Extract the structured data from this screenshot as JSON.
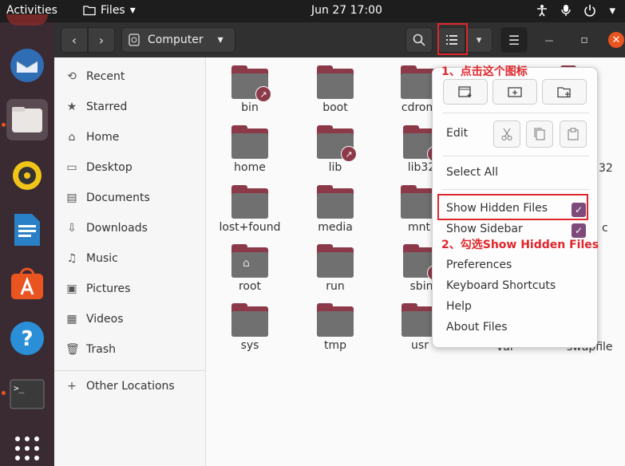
{
  "topbar": {
    "activities": "Activities",
    "app_name": "Files",
    "app_menu_arrow": "▾",
    "clock": "Jun 27  17:00"
  },
  "dock": {
    "items": [
      {
        "name": "thunderbird-icon"
      },
      {
        "name": "files-icon"
      },
      {
        "name": "rhythmbox-icon"
      },
      {
        "name": "writer-icon"
      },
      {
        "name": "app-center-icon"
      },
      {
        "name": "help-icon"
      },
      {
        "name": "terminal-icon"
      },
      {
        "name": "show-apps-icon"
      }
    ]
  },
  "header": {
    "back": "‹",
    "forward": "›",
    "location": "Computer",
    "location_arrow": "▾",
    "search": "⌕",
    "menu_arrow": "▾",
    "hamburger": "☰",
    "minimize": "—",
    "maximize": "▫",
    "close": "✕"
  },
  "sidebar": {
    "items": [
      {
        "label": "Recent",
        "icon": "⟲"
      },
      {
        "label": "Starred",
        "icon": "★"
      },
      {
        "label": "Home",
        "icon": "⌂"
      },
      {
        "label": "Desktop",
        "icon": "▭"
      },
      {
        "label": "Documents",
        "icon": "▤"
      },
      {
        "label": "Downloads",
        "icon": "⇩"
      },
      {
        "label": "Music",
        "icon": "♫"
      },
      {
        "label": "Pictures",
        "icon": "▣"
      },
      {
        "label": "Videos",
        "icon": "▦"
      },
      {
        "label": "Trash",
        "icon": "🗑"
      }
    ],
    "other_locations": {
      "label": "Other Locations",
      "icon": "+"
    }
  },
  "files": [
    {
      "name": "bin",
      "link": true
    },
    {
      "name": "boot",
      "link": false
    },
    {
      "name": "cdrom",
      "link": false
    },
    {
      "name": "home",
      "link": false
    },
    {
      "name": "lib",
      "link": true
    },
    {
      "name": "lib32",
      "link": true
    },
    {
      "name": "lost+found",
      "link": false
    },
    {
      "name": "media",
      "link": false
    },
    {
      "name": "mnt",
      "link": false
    },
    {
      "name": "root",
      "link": false,
      "home": true
    },
    {
      "name": "run",
      "link": false
    },
    {
      "name": "sbin",
      "link": true
    },
    {
      "name": "sys",
      "link": false
    },
    {
      "name": "tmp",
      "link": false
    },
    {
      "name": "usr",
      "link": false
    }
  ],
  "partial_files": {
    "right_row2": "32",
    "right_row3": "c",
    "var": "var",
    "swapfile": "swapfile"
  },
  "menu": {
    "edit_label": "Edit",
    "select_all": "Select All",
    "show_hidden_files": "Show Hidden Files",
    "show_sidebar": "Show Sidebar",
    "preferences": "Preferences",
    "keyboard_shortcuts": "Keyboard Shortcuts",
    "help": "Help",
    "about": "About Files",
    "check": "✓"
  },
  "annotations": {
    "step1": "1、点击这个图标",
    "step2": "2、勾选Show Hidden Files"
  },
  "colors": {
    "accent": "#e95420",
    "check": "#7d4a7a",
    "annotation": "#e0262b"
  }
}
